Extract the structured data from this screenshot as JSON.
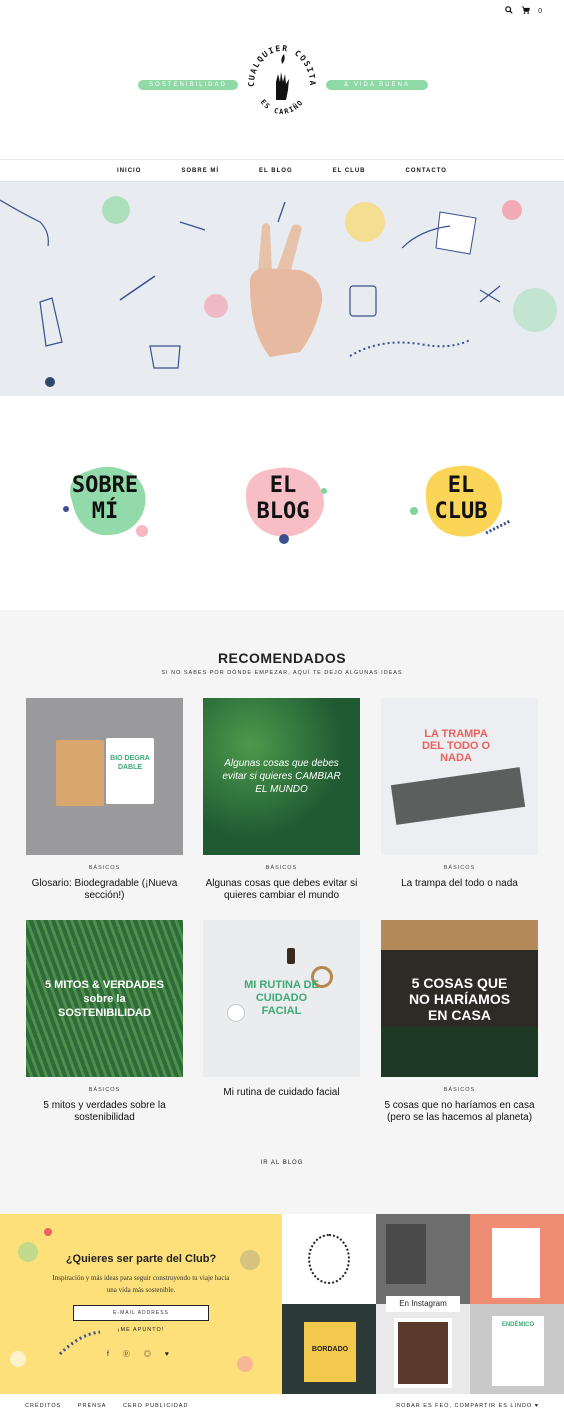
{
  "header": {
    "search_icon": "search-icon",
    "cart_icon": "cart-icon",
    "cart_count": "0",
    "pill_left": "SOSTENIBILIDAD",
    "pill_right": "& VIDA BUENA",
    "seal_top": "CUALQUIER COSITA",
    "seal_bottom": "ES CARIÑO"
  },
  "nav": {
    "items": [
      "INICIO",
      "SOBRE MÍ",
      "EL BLOG",
      "EL CLUB",
      "CONTACTO"
    ]
  },
  "sections": {
    "sobre": "SOBRE MÍ",
    "blog": "EL BLOG",
    "club": "EL CLUB",
    "colors": {
      "green": "#7fd49a",
      "pink": "#f6b7bf",
      "yellow": "#fbd34e"
    }
  },
  "recommended": {
    "title": "RECOMENDADOS",
    "subtitle": "SI NO SABES POR DÓNDE EMPEZAR, AQUÍ TE DEJO ALGUNAS IDEAS",
    "posts": [
      {
        "category": "BÁSICOS",
        "title": "Glosario: Biodegradable (¡Nueva sección!)",
        "overlay": "BIO DEGRA DABLE"
      },
      {
        "category": "BÁSICOS",
        "title": "Algunas cosas que debes evitar si quieres cambiar el mundo",
        "overlay": "Algunas cosas que debes evitar si quieres CAMBIAR EL MUNDO"
      },
      {
        "category": "BÁSICOS",
        "title": "La trampa del todo o nada",
        "overlay": "LA TRAMPA DEL TODO O NADA"
      },
      {
        "category": "BÁSICOS",
        "title": "5 mitos y verdades sobre la sostenibilidad",
        "overlay": "5 MITOS & VERDADES sobre la SOSTENIBILIDAD"
      },
      {
        "category": "",
        "title": "Mi rutina de cuidado facial",
        "overlay": "MI RUTINA DE CUIDADO FACIAL"
      },
      {
        "category": "BÁSICOS",
        "title": "5 cosas que no haríamos en casa (pero se las hacemos al planeta)",
        "overlay": "5 COSAS QUE NO HARÍAMOS EN CASA"
      }
    ],
    "more": "IR AL BLOG"
  },
  "club_box": {
    "title": "¿Quieres ser parte del Club?",
    "text": "Inspiración y más ideas para seguir construyendo tu viaje hacia una vida más sostenible.",
    "email_placeholder": "E-MAIL ADDRESS",
    "button": "¡ME APUNTO!",
    "social": "f ⓟ ◎ ♥"
  },
  "instagram": {
    "label": "En Instagram",
    "book_title": "BORDADO",
    "poster_title": "ENDÉMICO"
  },
  "footer": {
    "links": [
      "CRÉDITOS",
      "PRENSA",
      "CERO PUBLICIDAD"
    ],
    "right": "ROBAR ES FEO, COMPARTIR ES LINDO ♥"
  }
}
